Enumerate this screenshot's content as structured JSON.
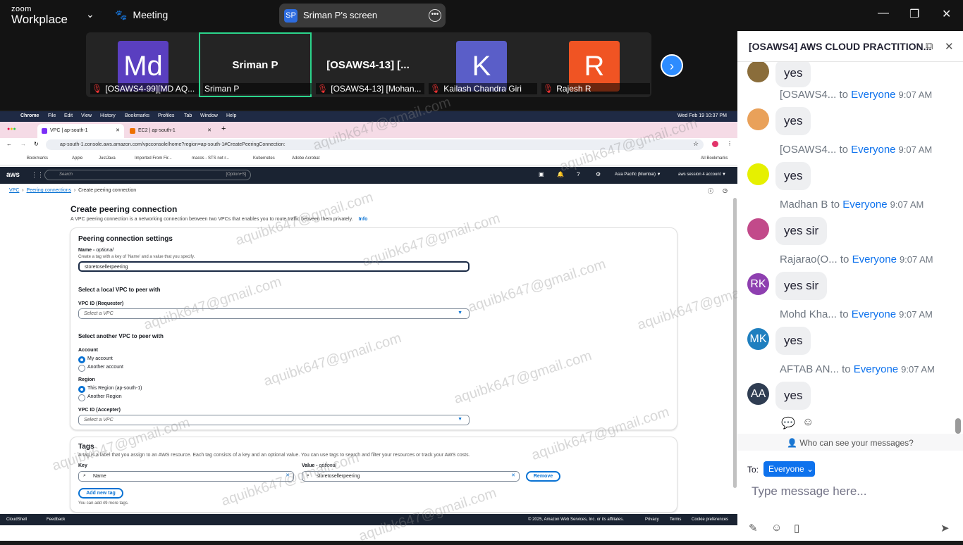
{
  "zoom": {
    "logo_top": "zoom",
    "logo_bottom": "Workplace",
    "meeting_label": "Meeting",
    "share_initials": "SP",
    "share_label": "Sriman P's screen"
  },
  "participants": [
    {
      "initials": "Md",
      "name": "[OSAWS4-99][MD AQ...",
      "color": "#5a3fc0"
    },
    {
      "big": "Sriman P",
      "name": "Sriman P"
    },
    {
      "big": "[OSAWS4-13] [...",
      "name": "[OSAWS4-13] [Mohan..."
    },
    {
      "initials": "K",
      "name": "Kailash Chandra Giri",
      "color": "#5a5ec8"
    },
    {
      "initials": "R",
      "name": "Rajesh R",
      "color": "#f05423"
    }
  ],
  "mac": {
    "app": "Chrome",
    "menus": [
      "File",
      "Edit",
      "View",
      "History",
      "Bookmarks",
      "Profiles",
      "Tab",
      "Window",
      "Help"
    ],
    "clock": "Wed Feb 19  10:37 PM"
  },
  "browser": {
    "tabs": [
      {
        "label": "VPC | ap-south-1",
        "color": "#7b2ff7"
      },
      {
        "label": "EC2 | ap-south-1",
        "color": "#ed7100"
      }
    ],
    "new_tab": "+",
    "url": "ap-south-1.console.aws.amazon.com/vpcconsole/home?region=ap-south-1#CreatePeeringConnection:",
    "bookmarks": [
      "Bookmarks",
      "Apple",
      "JustJava",
      "Imported From Fir...",
      "macos - STS not r...",
      "Kubernetes",
      "Adobe Acrobat"
    ],
    "all_bookmarks": "All Bookmarks"
  },
  "aws": {
    "logo": "aws",
    "search_placeholder": "Search",
    "search_shortcut": "[Option+S]",
    "region": "Asia Pacific (Mumbai) ▼",
    "account": "aws session 4 account ▼",
    "breadcrumb": [
      "VPC",
      "Peering connections",
      "Create peering connection"
    ],
    "page_title": "Create peering connection",
    "page_desc": "A VPC peering connection is a networking connection between two VPCs that enables you to route traffic between them privately.",
    "info": "Info",
    "settings_title": "Peering connection settings",
    "name_label": "Name",
    "optional": "optional",
    "name_hint": "Create a tag with a key of 'Name' and a value that you specify.",
    "name_value": "storetosellerpeering",
    "local_vpc_title": "Select a local VPC to peer with",
    "vpc_requester": "VPC ID (Requester)",
    "select_vpc": "Select a VPC",
    "another_vpc_title": "Select another VPC to peer with",
    "account_label": "Account",
    "my_account": "My account",
    "another_account": "Another account",
    "region_label": "Region",
    "this_region": "This Region (ap-south-1)",
    "another_region": "Another Region",
    "vpc_accepter": "VPC ID (Accepter)",
    "tags_title": "Tags",
    "tags_desc": "A tag is a label that you assign to an AWS resource. Each tag consists of a key and an optional value. You can use tags to search and filter your resources or track your AWS costs.",
    "key_label": "Key",
    "value_label": "Value",
    "key_value": "Name",
    "tag_value": "storetosellerpeering",
    "remove": "Remove",
    "add_tag": "Add new tag",
    "tag_limit": "You can add 49 more tags.",
    "footer": {
      "cloudshell": "CloudShell",
      "feedback": "Feedback",
      "copyright": "© 2025, Amazon Web Services, Inc. or its affiliates.",
      "privacy": "Privacy",
      "terms": "Terms",
      "cookies": "Cookie preferences"
    }
  },
  "watermark": "aquibk647@gmail.com",
  "chat": {
    "title": "[OSAWS4] AWS CLOUD PRACTITION...",
    "to_everyone": "to",
    "everyone": "Everyone",
    "messages": [
      {
        "sender": "",
        "time": "",
        "text": "yes",
        "avatar": "",
        "avcolor": "#8a6d3b"
      },
      {
        "sender": "[OSAWS4...",
        "time": "9:07 AM",
        "text": "yes",
        "avatar": "",
        "avcolor": "#e9a15a"
      },
      {
        "sender": "[OSAWS4...",
        "time": "9:07 AM",
        "text": "yes",
        "avatar": "",
        "avcolor": "#e6f000"
      },
      {
        "sender": "Madhan B",
        "time": "9:07 AM",
        "text": "yes sir",
        "avatar": "",
        "avcolor": "#c24a8a"
      },
      {
        "sender": "Rajarao(O...",
        "time": "9:07 AM",
        "text": "yes sir",
        "avatar": "RK",
        "avcolor": "#8e3fb0"
      },
      {
        "sender": "Mohd Kha...",
        "time": "9:07 AM",
        "text": "yes",
        "avatar": "MK",
        "avcolor": "#1f7fbf"
      },
      {
        "sender": "AFTAB AN...",
        "time": "9:07 AM",
        "text": "yes",
        "avatar": "AA",
        "avcolor": "#2f3d52"
      }
    ],
    "who_can_see": "Who can see your messages?",
    "to_label": "To:",
    "recipient": "Everyone",
    "placeholder": "Type message here..."
  }
}
